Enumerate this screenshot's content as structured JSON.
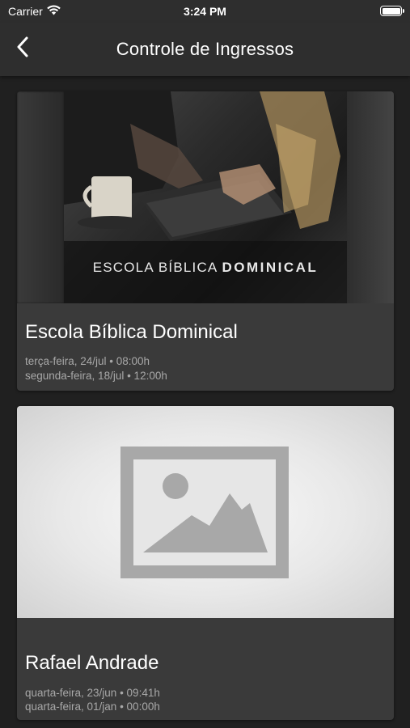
{
  "status_bar": {
    "carrier": "Carrier",
    "time": "3:24 PM",
    "wifi_icon": "wifi-icon",
    "battery_icon": "battery-icon"
  },
  "nav": {
    "title": "Controle de Ingressos",
    "back_icon": "chevron-left-icon"
  },
  "events": [
    {
      "title": "Escola Bíblica Dominical",
      "banner_text_light": "ESCOLA BÍBLICA",
      "banner_text_bold": "DOMINICAL",
      "dates": [
        "terça-feira, 24/jul • 08:00h",
        "segunda-feira, 18/jul • 12:00h"
      ]
    },
    {
      "title": "Rafael Andrade",
      "image_icon": "image-placeholder-icon",
      "dates": [
        "quarta-feira, 23/jun • 09:41h",
        "quarta-feira, 01/jan • 00:00h"
      ]
    }
  ],
  "colors": {
    "background": "#202020",
    "bar": "#2e2e2e",
    "card": "#3a3a3a",
    "text_primary": "#ffffff",
    "text_secondary": "#a8a8a8"
  }
}
